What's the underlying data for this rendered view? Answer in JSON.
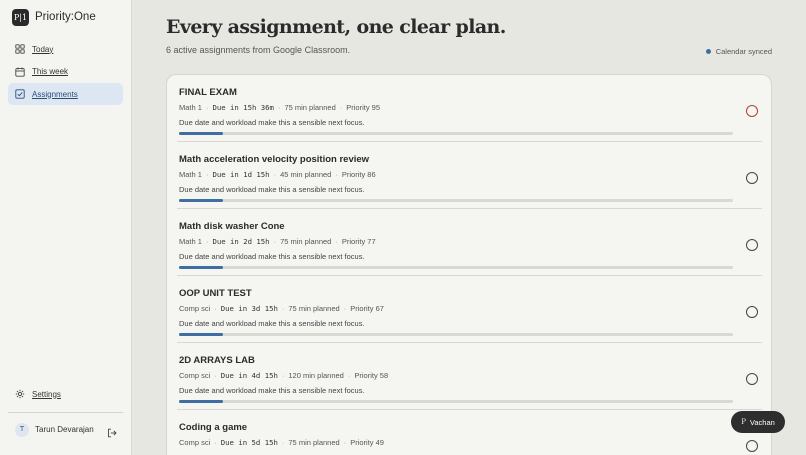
{
  "app": {
    "logo_text": "P|1",
    "name": "Priority:One"
  },
  "nav": [
    {
      "label": "Today",
      "icon": "grid-icon"
    },
    {
      "label": "This week",
      "icon": "calendar-icon"
    },
    {
      "label": "Assignments",
      "icon": "checkbox-icon",
      "active": true
    }
  ],
  "settings_label": "Settings",
  "user": {
    "initial": "T",
    "name": "Tarun Devarajan"
  },
  "header": {
    "title": "Every assignment, one clear plan.",
    "subtitle": "6 active assignments from Google Classroom.",
    "sync_status": "Calendar synced"
  },
  "assignments": [
    {
      "title": "FINAL EXAM",
      "course": "Math 1",
      "due": "Due in 15h 36m",
      "planned": "75 min planned",
      "priority": "Priority 95",
      "reason": "Due date and workload make this a sensible next focus.",
      "progress": 0.08,
      "urgent": true
    },
    {
      "title": "Math acceleration velocity position review",
      "course": "Math 1",
      "due": "Due in 1d 15h",
      "planned": "45 min planned",
      "priority": "Priority 86",
      "reason": "Due date and workload make this a sensible next focus.",
      "progress": 0.08,
      "urgent": false
    },
    {
      "title": "Math disk washer Cone",
      "course": "Math 1",
      "due": "Due in 2d 15h",
      "planned": "75 min planned",
      "priority": "Priority 77",
      "reason": "Due date and workload make this a sensible next focus.",
      "progress": 0.08,
      "urgent": false
    },
    {
      "title": "OOP UNIT TEST",
      "course": "Comp sci",
      "due": "Due in 3d 15h",
      "planned": "75 min planned",
      "priority": "Priority 67",
      "reason": "Due date and workload make this a sensible next focus.",
      "progress": 0.08,
      "urgent": false
    },
    {
      "title": "2D ARRAYS LAB",
      "course": "Comp sci",
      "due": "Due in 4d 15h",
      "planned": "120 min planned",
      "priority": "Priority 58",
      "reason": "Due date and workload make this a sensible next focus.",
      "progress": 0.08,
      "urgent": false
    },
    {
      "title": "Coding a game",
      "course": "Comp sci",
      "due": "Due in 5d 15h",
      "planned": "75 min planned",
      "priority": "Priority 49",
      "reason": "",
      "progress": 0.08,
      "urgent": false
    }
  ],
  "assistant_chip": {
    "mark": "P",
    "label": "Vachan"
  },
  "colors": {
    "accent": "#3f6ea3",
    "urgent": "#b53b3b",
    "active_nav_bg": "#dce7f3"
  }
}
